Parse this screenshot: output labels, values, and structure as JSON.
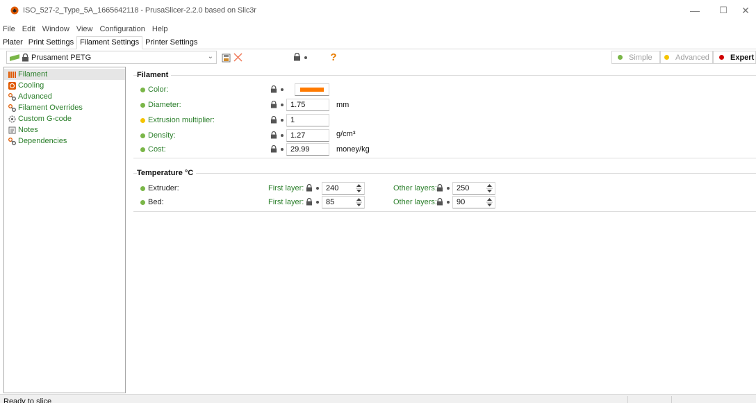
{
  "window": {
    "title": "ISO_527-2_Type_5A_1665642118 - PrusaSlicer-2.2.0 based on Slic3r",
    "minimize": "—",
    "maximize": "☐",
    "close": "✕"
  },
  "menu": [
    "File",
    "Edit",
    "Window",
    "View",
    "Configuration",
    "Help"
  ],
  "tabs": [
    "Plater",
    "Print Settings",
    "Filament Settings",
    "Printer Settings"
  ],
  "active_tab": "Filament Settings",
  "preset": {
    "name": "Prusament PETG",
    "arrow": "⌄"
  },
  "toolbar": {
    "question_mark": "?"
  },
  "modes": {
    "simple": "Simple",
    "advanced": "Advanced",
    "expert": "Expert"
  },
  "colors": {
    "simple_dot": "#7ab648",
    "advanced_dot": "#f5c400",
    "expert_dot": "#d00000",
    "label_green": "#2b7f2b",
    "filament_color": "#ff7a00"
  },
  "sidebar": {
    "items": [
      {
        "label": "Filament",
        "icon": "spool-icon"
      },
      {
        "label": "Cooling",
        "icon": "fan-icon"
      },
      {
        "label": "Advanced",
        "icon": "wrench-icon"
      },
      {
        "label": "Filament Overrides",
        "icon": "wrench-icon"
      },
      {
        "label": "Custom G-code",
        "icon": "cog-icon"
      },
      {
        "label": "Notes",
        "icon": "note-icon"
      },
      {
        "label": "Dependencies",
        "icon": "wrench-icon"
      }
    ]
  },
  "filament_group": {
    "title": "Filament",
    "rows": [
      {
        "label": "Color:",
        "value": "",
        "unit": ""
      },
      {
        "label": "Diameter:",
        "value": "1.75",
        "unit": "mm"
      },
      {
        "label": "Extrusion multiplier:",
        "value": "1",
        "unit": ""
      },
      {
        "label": "Density:",
        "value": "1.27",
        "unit": "g/cm³"
      },
      {
        "label": "Cost:",
        "value": "29.99",
        "unit": "money/kg"
      }
    ]
  },
  "temperature_group": {
    "title": "Temperature °C",
    "first_layer_label": "First layer:",
    "other_layers_label": "Other layers:",
    "rows": [
      {
        "label": "Extruder:",
        "first_layer": "240",
        "other_layers": "250"
      },
      {
        "label": "Bed:",
        "first_layer": "85",
        "other_layers": "90"
      }
    ]
  },
  "status": {
    "text": "Ready to slice"
  }
}
